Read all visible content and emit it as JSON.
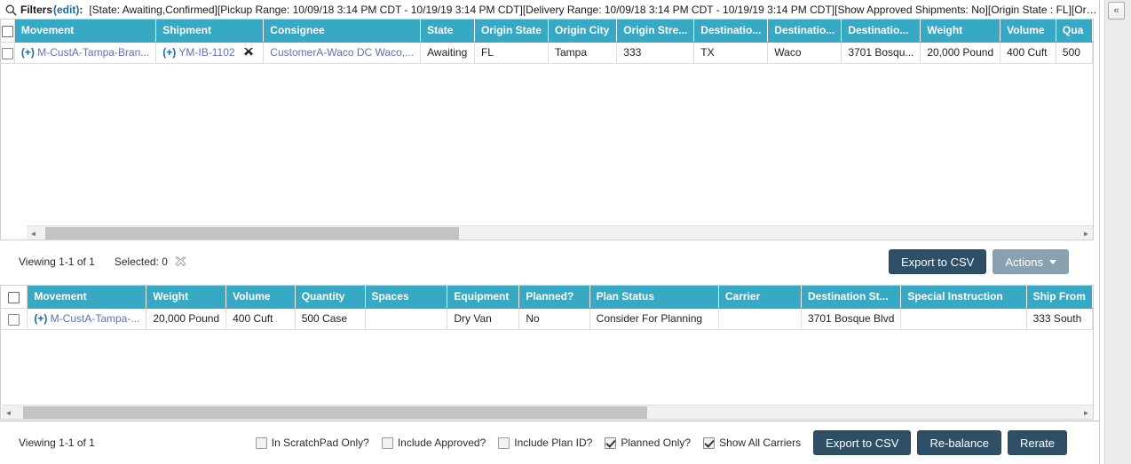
{
  "filters": {
    "search_icon": "search-icon",
    "label": "Filters",
    "edit_link": "(edit)",
    "colon": ":",
    "text": "[State: Awaiting,Confirmed][Pickup Range: 10/09/18 3:14 PM CDT - 10/19/19 3:14 PM CDT][Delivery Range: 10/09/18 3:14 PM CDT - 10/19/19 3:14 PM CDT][Show Approved Shipments: No][Origin State : FL][Origin City: TAMPA][..."
  },
  "panel": {
    "collapse_icon": "chevron-double-left-icon",
    "collapse_glyph": "«"
  },
  "top_grid": {
    "columns": [
      "Movement",
      "Shipment",
      "Consignee",
      "State",
      "Origin State",
      "Origin City",
      "Origin Stre...",
      "Destinatio...",
      "Destinatio...",
      "Destinatio...",
      "Weight",
      "Volume",
      "Qua"
    ],
    "rows": [
      {
        "movement_plus": "(+)",
        "movement": "M-CustA-Tampa-Bran...",
        "shipment_plus": "(+)",
        "shipment": "YM-IB-1102",
        "shipment_icon": "cross-shuffle-icon",
        "consignee": "CustomerA-Waco DC Waco,...",
        "state": "Awaiting",
        "origin_state": "FL",
        "origin_city": "Tampa",
        "origin_street": "333",
        "destination_state": "TX",
        "destination_city": "Waco",
        "destination_street": "3701 Bosqu...",
        "weight": "20,000 Pound",
        "volume": "400 Cuft",
        "quantity": "500"
      }
    ],
    "scroll": {
      "left_arrow": "◄",
      "right_arrow": "►"
    }
  },
  "top_status": {
    "viewing": "Viewing 1-1 of 1",
    "selected": "Selected: 0",
    "clear_icon": "cross-shuffle-icon",
    "export_label": "Export to CSV",
    "actions_label": "Actions",
    "actions_caret": "caret-down-icon"
  },
  "bottom_grid": {
    "columns": [
      "Movement",
      "Weight",
      "Volume",
      "Quantity",
      "Spaces",
      "Equipment",
      "Planned?",
      "Plan Status",
      "Carrier",
      "Destination St...",
      "Special Instruction",
      "Ship From"
    ],
    "rows": [
      {
        "movement_plus": "(+)",
        "movement": "M-CustA-Tampa-...",
        "weight": "20,000 Pound",
        "volume": "400 Cuft",
        "quantity": "500 Case",
        "spaces": "",
        "equipment": "Dry Van",
        "planned": "No",
        "plan_status": "Consider For Planning",
        "carrier": "",
        "destination_street": "3701 Bosque Blvd",
        "special_instruction": "",
        "ship_from": "333 South"
      }
    ],
    "scroll": {
      "left_arrow": "◄",
      "right_arrow": "►"
    }
  },
  "bottom_status": {
    "viewing": "Viewing 1-1 of 1",
    "checkboxes": [
      {
        "label": "In ScratchPad Only?",
        "checked": false
      },
      {
        "label": "Include Approved?",
        "checked": false
      },
      {
        "label": "Include Plan ID?",
        "checked": false
      },
      {
        "label": "Planned Only?",
        "checked": true
      },
      {
        "label": "Show All Carriers",
        "checked": true
      }
    ],
    "export_label": "Export to CSV",
    "rebalance_label": "Re-balance",
    "rerate_label": "Rerate"
  },
  "colors": {
    "header_teal": "#37a9c4",
    "button_navy": "#2e4f66",
    "button_grey_blue": "#8aa2b0",
    "link_blue": "#1769b0"
  }
}
